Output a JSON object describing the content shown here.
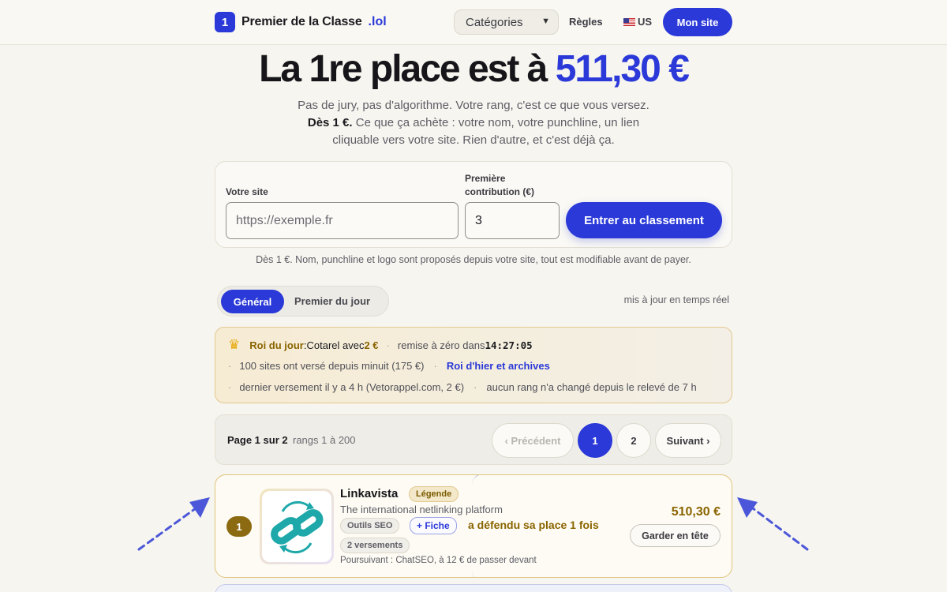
{
  "header": {
    "brand_number": "1",
    "brand_name": "Premier de la Classe",
    "brand_tld": ".lol",
    "category_select": "Catégories",
    "rules_link": "Règles",
    "lang": "US",
    "cta": "Mon site"
  },
  "hero": {
    "title_prefix": "La 1re place est à ",
    "title_amount": "511,30 €",
    "line1": "Pas de jury, pas d'algorithme. Votre rang, c'est ce que vous versez.",
    "line2_bold": "Dès 1 €.",
    "line2_rest": " Ce que ça achète : votre nom, votre punchline, un lien",
    "line3": "cliquable vers votre site. Rien d'autre, et c'est déjà ça."
  },
  "form": {
    "site_label": "Votre site",
    "site_placeholder": "https://exemple.fr",
    "contribution_label": "Première contribution (€)",
    "contribution_value": "3",
    "submit": "Entrer au classement",
    "note": "Dès 1 €. Nom, punchline et logo sont proposés depuis votre site, tout est modifiable avant de payer."
  },
  "tabs": {
    "active": "Général",
    "other": "Premier du jour",
    "realtime": "mis à jour en temps réel"
  },
  "king": {
    "label": "Roi du jour",
    "sep": " : ",
    "name_with": "Cotarel avec ",
    "amount": "2 €",
    "reset_label": "remise à zéro dans ",
    "countdown": "14:27:05",
    "sites_since_midnight": "100 sites ont versé depuis minuit (175 €)",
    "archives_link": "Roi d'hier et archives",
    "last_payment": "dernier versement il y a 4 h (Vetorappel.com, 2 €)",
    "no_change": "aucun rang n'a changé depuis le relevé de 7 h"
  },
  "pager": {
    "label": "Page 1 sur 2",
    "range": "rangs 1 à 200",
    "prev": "‹ Précédent",
    "page1": "1",
    "page2": "2",
    "next": "Suivant ›"
  },
  "rank1": {
    "rank": "1",
    "name": "Linkavista",
    "badge": "Légende",
    "tagline": "The international netlinking platform",
    "category_chip": "Outils SEO",
    "fiche_chip": "+ Fiche",
    "defended": "a défendu sa place 1 fois",
    "payments_chip": "2 versements",
    "chaser": "Poursuivant : ChatSEO, à 12 € de passer devant",
    "amount": "510,30 €",
    "keep_button": "Garder en tête"
  },
  "colors": {
    "accent": "#2a39d8",
    "gold": "#8a6400",
    "logo_teal": "#1ea8a9"
  }
}
